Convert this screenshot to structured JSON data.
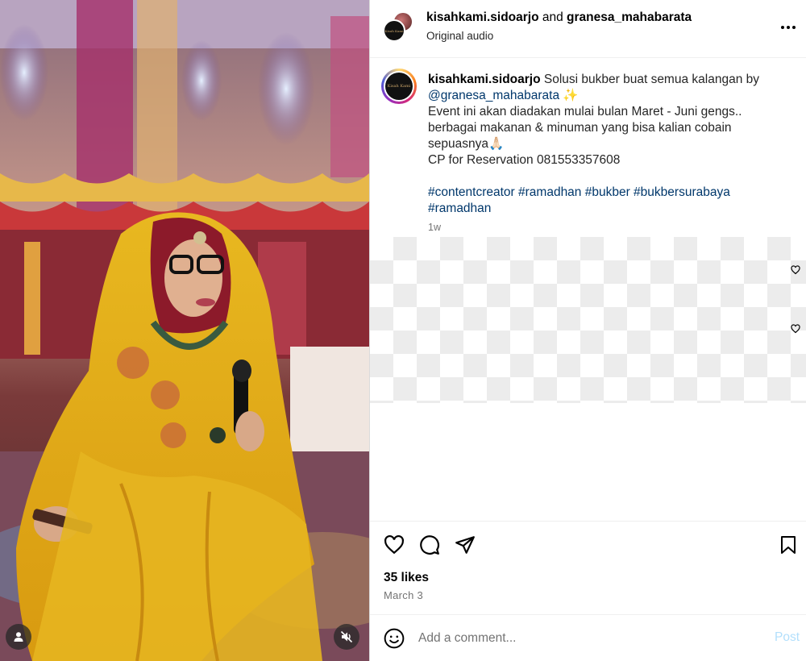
{
  "header": {
    "user1": "kisahkami.sidoarjo",
    "joiner": " and ",
    "user2": "granesa_mahabarata",
    "audio": "Original audio",
    "more_icon": "more-horizontal-icon"
  },
  "avatar_logo_text": "Kisah Kami",
  "caption": {
    "username": "kisahkami.sidoarjo",
    "line1_text": " Solusi bukber buat semua kalangan by",
    "mention": "@granesa_mahabarata",
    "sparkle": " ✨",
    "line2": "Event ini akan diadakan mulai bulan Maret - Juni gengs..",
    "line3": "berbagai makanan & minuman yang bisa kalian cobain",
    "line4": "sepuasnya🙏🏻",
    "line5": "CP for Reservation 081553357608",
    "hashtags_line1": "#contentcreator #ramadhan #bukber #bukbersurabaya",
    "hashtags_line2": "#ramadhan",
    "time": "1w"
  },
  "actions": {
    "like_icon": "heart-icon",
    "comment_icon": "comment-icon",
    "share_icon": "share-icon",
    "save_icon": "bookmark-icon"
  },
  "likes": "35 likes",
  "date": "March 3",
  "comment_bar": {
    "emoji_icon": "emoji-icon",
    "placeholder": "Add a comment...",
    "post_label": "Post"
  },
  "colors": {
    "link": "#00376b",
    "muted": "#737373",
    "post_disabled": "#b2dffc",
    "border": "#dbdbdb"
  }
}
